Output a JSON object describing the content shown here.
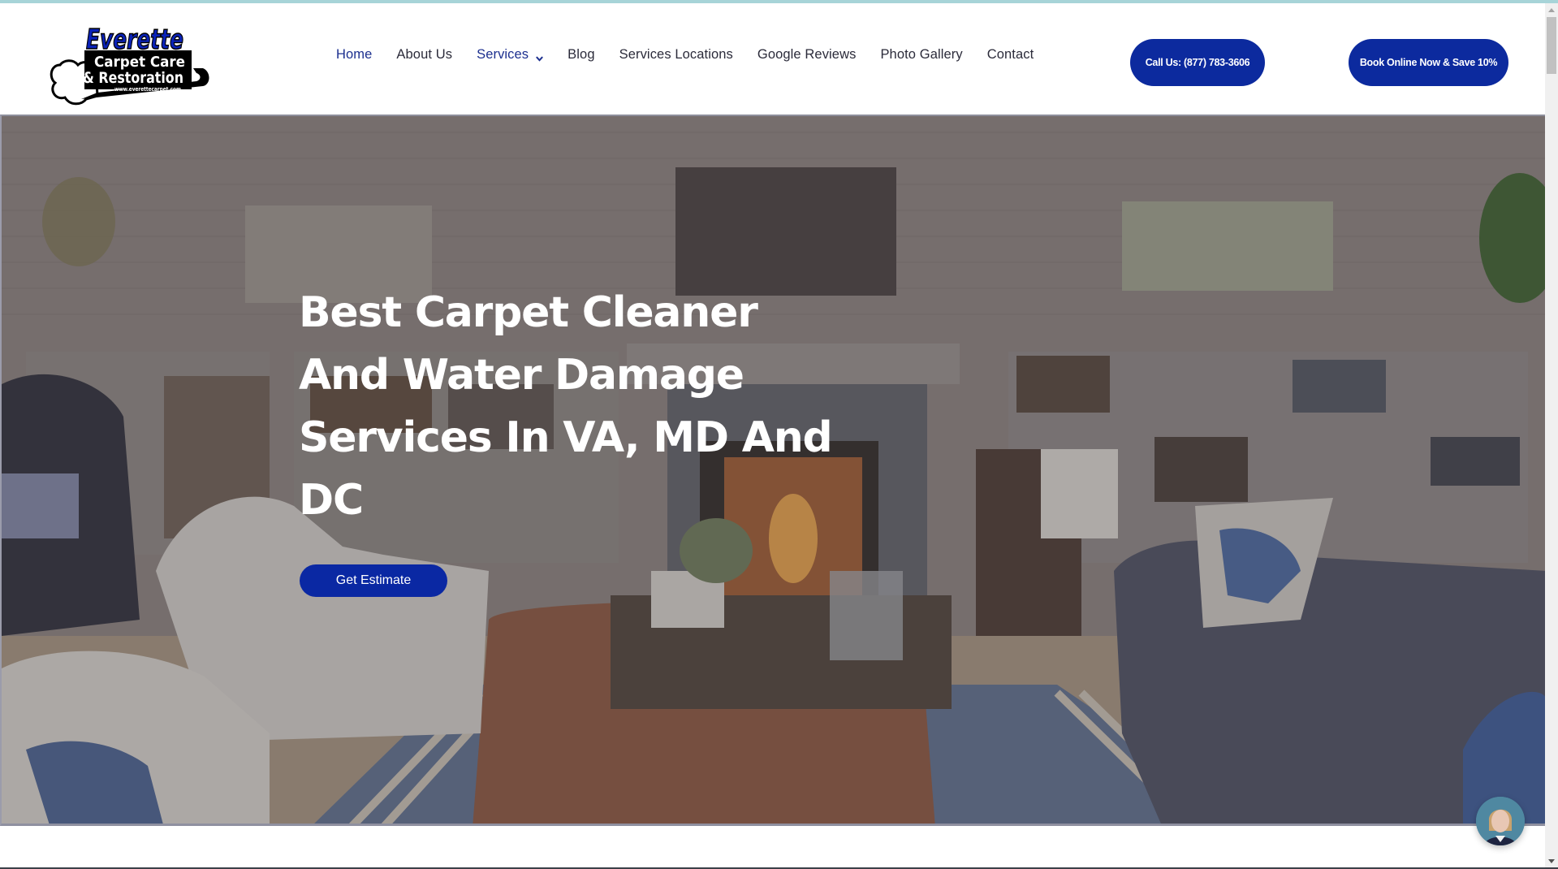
{
  "brand": {
    "logo_line1": "Everette",
    "logo_line2": "Carpet Care",
    "logo_line3": "& Restoration",
    "logo_url_text": "www.everettecarpet.com",
    "accent_color": "#0c2a9e"
  },
  "nav": {
    "items": [
      {
        "label": "Home",
        "active": true
      },
      {
        "label": "About Us"
      },
      {
        "label": "Services",
        "has_dropdown": true
      },
      {
        "label": "Blog"
      },
      {
        "label": "Services Locations"
      },
      {
        "label": "Google Reviews"
      },
      {
        "label": "Photo Gallery"
      },
      {
        "label": "Contact"
      }
    ]
  },
  "header_buttons": {
    "call": "Call Us: (877) 783-3606",
    "book": "Book Online Now & Save 10%"
  },
  "hero": {
    "title_lines": [
      "Best Carpet Cleaner",
      "And Water Damage",
      "Services In VA, MD And",
      "DC"
    ],
    "cta": "Get Estimate"
  },
  "chat_widget": {
    "icon": "support-agent-avatar"
  }
}
